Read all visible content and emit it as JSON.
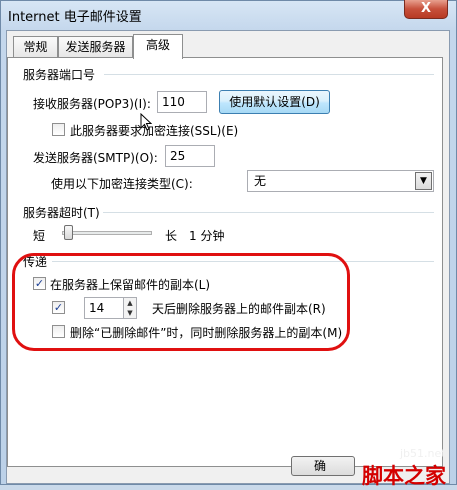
{
  "window": {
    "title": "Internet 电子邮件设置",
    "close_label": "X"
  },
  "tabs": [
    {
      "label": "常规"
    },
    {
      "label": "发送服务器"
    },
    {
      "label": "高级",
      "active": true
    }
  ],
  "ports": {
    "group_label": "服务器端口号",
    "incoming_label": "接收服务器(POP3)(I):",
    "incoming_value": "110",
    "default_button": "使用默认设置(D)",
    "ssl_label": "此服务器要求加密连接(SSL)(E)",
    "ssl_checked": false,
    "outgoing_label": "发送服务器(SMTP)(O):",
    "outgoing_value": "25",
    "encryption_label": "使用以下加密连接类型(C):",
    "encryption_value": "无"
  },
  "timeout": {
    "group_label": "服务器超时(T)",
    "short_label": "短",
    "long_label": "长",
    "value": "1 分钟",
    "level": 0.03
  },
  "delivery": {
    "group_label": "传递",
    "keep_copy_label": "在服务器上保留邮件的副本(L)",
    "keep_copy_checked": true,
    "remove_after_checked": true,
    "remove_after_days": "14",
    "remove_after_label": "天后删除服务器上的邮件副本(R)",
    "remove_deleted_label": "删除“已删除邮件”时，同时删除服务器上的副本(M)",
    "remove_deleted_checked": false
  },
  "footer": {
    "ok_button_partial": "确"
  },
  "watermark": {
    "site": "jb51.net",
    "brand": "脚本之家"
  },
  "colors": {
    "annotation": "#e01010",
    "brand": "#d40000",
    "button_border": "#3c7fb1"
  }
}
